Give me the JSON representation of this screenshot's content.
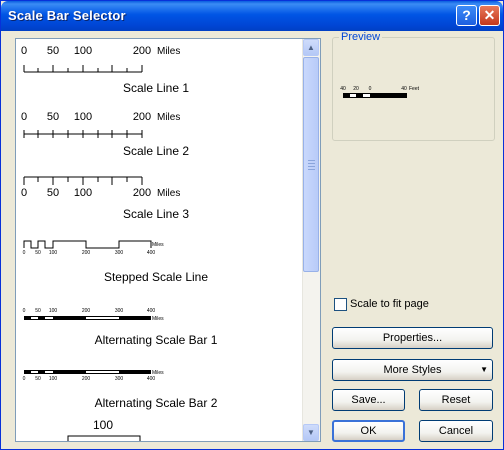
{
  "window": {
    "title": "Scale Bar Selector",
    "help_button": "?",
    "close_button": "✕"
  },
  "list": {
    "items": [
      {
        "label": "Scale Line 1",
        "ticks": [
          "0",
          "50",
          "100",
          "200"
        ],
        "units": "Miles"
      },
      {
        "label": "Scale Line 2",
        "ticks": [
          "0",
          "50",
          "100",
          "200"
        ],
        "units": "Miles"
      },
      {
        "label": "Scale Line 3",
        "ticks": [
          "0",
          "50",
          "100",
          "200"
        ],
        "units": "Miles"
      },
      {
        "label": "Stepped Scale Line",
        "ticks": [
          "0",
          "50",
          "100",
          "200",
          "300",
          "400"
        ],
        "units": "Miles"
      },
      {
        "label": "Alternating Scale Bar 1",
        "ticks": [
          "0",
          "50",
          "100",
          "200",
          "300",
          "400"
        ],
        "units": "Miles"
      },
      {
        "label": "Alternating Scale Bar 2",
        "ticks": [
          "0",
          "50",
          "100",
          "200",
          "300",
          "400"
        ],
        "units": "Miles"
      },
      {
        "label": "",
        "ticks": [
          "100"
        ],
        "units": ""
      }
    ]
  },
  "preview": {
    "title": "Preview",
    "ticks": [
      "40",
      "20",
      "0",
      "40"
    ],
    "units": "Feet"
  },
  "options": {
    "scale_to_fit_label": "Scale to fit page",
    "scale_to_fit_checked": false
  },
  "buttons": {
    "properties": "Properties...",
    "more_styles": "More Styles",
    "save": "Save...",
    "reset": "Reset",
    "ok": "OK",
    "cancel": "Cancel"
  },
  "icons": {
    "scroll_up": "chevron-up-icon",
    "scroll_down": "chevron-down-icon",
    "dropdown": "triangle-down-icon"
  }
}
